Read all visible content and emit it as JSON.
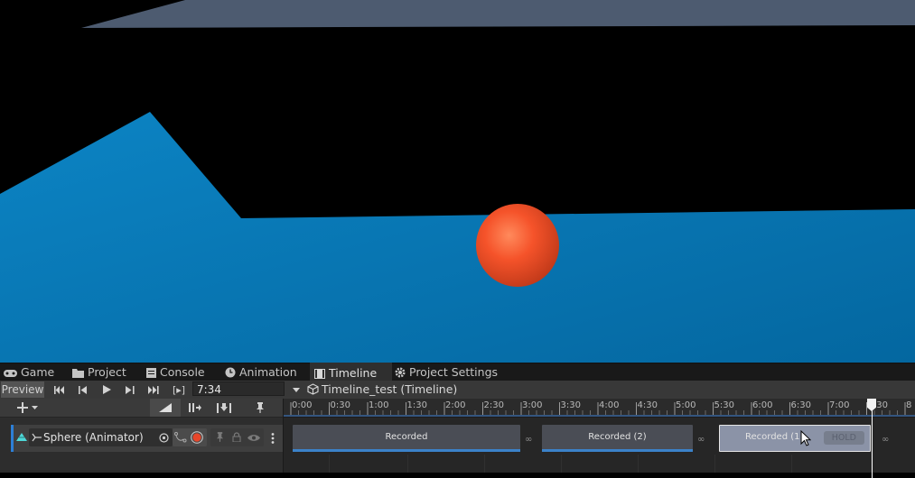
{
  "tabs": [
    {
      "label": "Game",
      "icon": "gamepad-icon"
    },
    {
      "label": "Project",
      "icon": "folder-icon"
    },
    {
      "label": "Console",
      "icon": "console-icon"
    },
    {
      "label": "Animation",
      "icon": "clock-icon"
    },
    {
      "label": "Timeline",
      "icon": "film-icon",
      "active": true
    },
    {
      "label": "Project Settings",
      "icon": "gear-icon"
    }
  ],
  "toolbar": {
    "preview_label": "Preview",
    "time_value": "7:34",
    "frame_toggle": "[▸]",
    "breadcrumb": "Timeline_test (Timeline)"
  },
  "track": {
    "name": "Sphere (Animator)"
  },
  "ruler": {
    "ticks": [
      "0:00",
      "0:30",
      "1:00",
      "1:30",
      "2:00",
      "2:30",
      "3:00",
      "3:30",
      "4:00",
      "4:30",
      "5:00",
      "5:30",
      "6:00",
      "6:30",
      "7:00",
      "7:30",
      "8"
    ]
  },
  "clips": [
    {
      "label": "Recorded"
    },
    {
      "label": "Recorded (2)"
    },
    {
      "label": "Recorded (1"
    }
  ],
  "hold_label": "HOLD",
  "colors": {
    "accent": "#3b82c9",
    "floor": "#0a75b0",
    "ball": "#ff5a2a"
  }
}
